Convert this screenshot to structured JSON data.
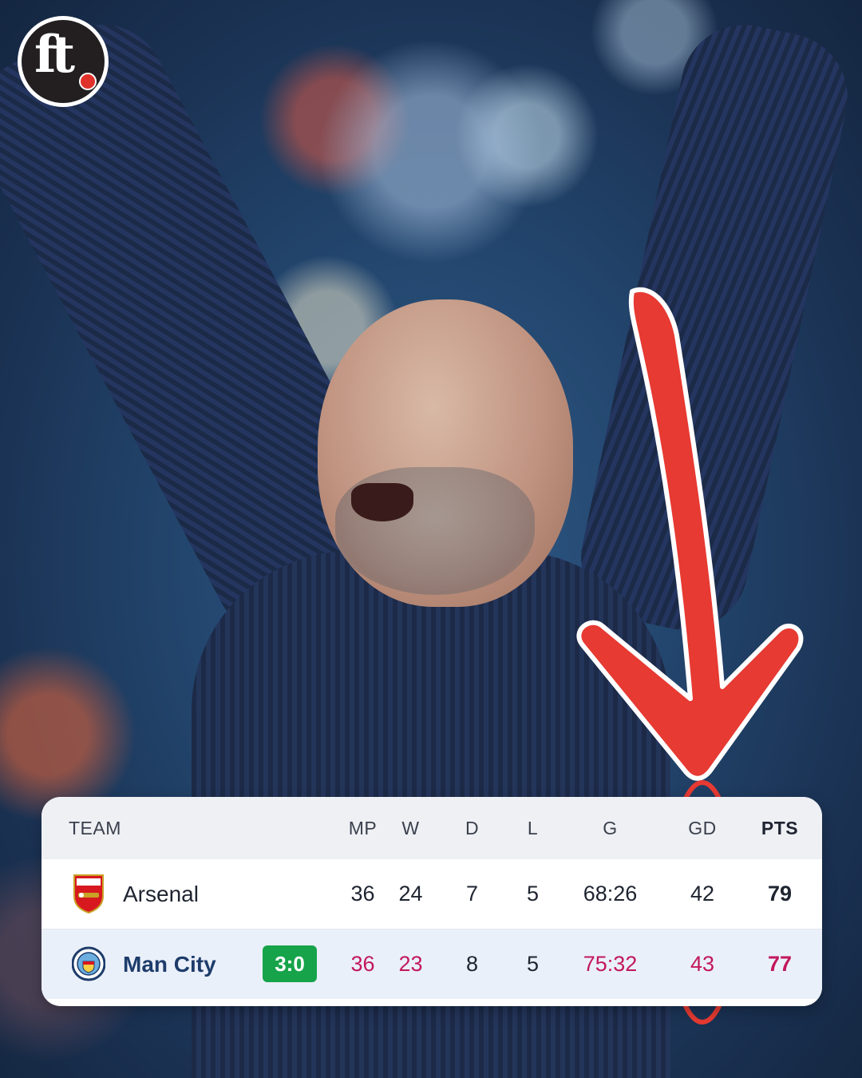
{
  "logo": {
    "text": "ft",
    "icon": "football-icon"
  },
  "table": {
    "headers": {
      "team": "TEAM",
      "mp": "MP",
      "w": "W",
      "d": "D",
      "l": "L",
      "g": "G",
      "gd": "GD",
      "pts": "PTS"
    },
    "rows": [
      {
        "team": "Arsenal",
        "crest": "arsenal-crest-icon",
        "mp": "36",
        "w": "24",
        "d": "7",
        "l": "5",
        "g": "68:26",
        "gd": "42",
        "pts": "79"
      },
      {
        "team": "Man City",
        "crest": "man-city-crest-icon",
        "live_score": "3:0",
        "mp": "36",
        "w": "23",
        "d": "8",
        "l": "5",
        "g": "75:32",
        "gd": "43",
        "pts": "77"
      }
    ]
  },
  "colors": {
    "arrow": "#e63a32",
    "score_badge": "#16a34a",
    "highlight_text": "#c2185b",
    "team_highlight": "#1d3c6b"
  }
}
